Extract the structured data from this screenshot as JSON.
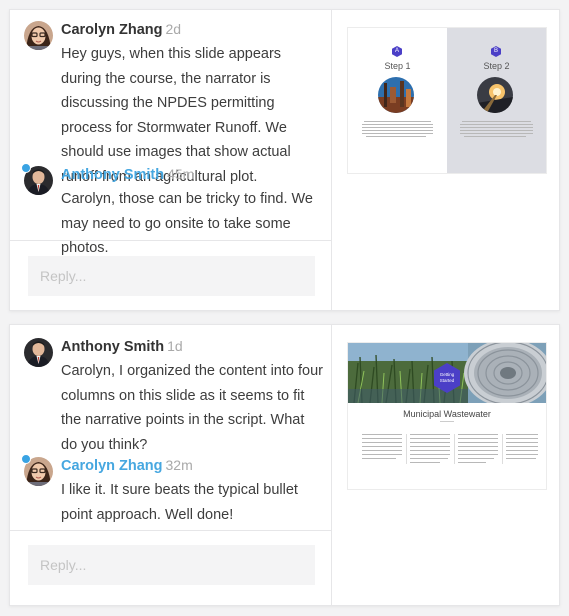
{
  "threads": [
    {
      "comments": [
        {
          "author": "Carolyn Zhang",
          "time": "2d",
          "text": "Hey guys, when this slide appears during the course, the narrator is discussing the NPDES permitting process for Stormwater Runoff. We should use images that show actual runoff from an agricultural plot.",
          "unread": false,
          "author_color": "#333333"
        },
        {
          "author": "Anthony Smith",
          "time": "45m",
          "text": "Carolyn, those can be tricky to find. We may need to go onsite to take some photos.",
          "unread": true,
          "author_color": "#46a7e0"
        }
      ],
      "reply_placeholder": "Reply...",
      "slide": {
        "step1_badge": "A",
        "step1_label": "Step 1",
        "step2_badge": "B",
        "step2_label": "Step 2"
      }
    },
    {
      "comments": [
        {
          "author": "Anthony Smith",
          "time": "1d",
          "text": "Carolyn, I organized the content into four columns on this slide as it seems to fit the narrative points in the script. What do you think?",
          "unread": false,
          "author_color": "#333333"
        },
        {
          "author": "Carolyn Zhang",
          "time": "32m",
          "text": "I like it. It sure beats the typical bullet point approach. Well done!",
          "unread": true,
          "author_color": "#46a7e0"
        }
      ],
      "reply_placeholder": "Reply...",
      "slide": {
        "badge": "Getting Started",
        "title": "Municipal Wastewater"
      }
    }
  ],
  "colors": {
    "accent_blue": "#46a7e0",
    "slide_purple": "#4b3fc7",
    "unread_dot": "#39a3e3"
  }
}
